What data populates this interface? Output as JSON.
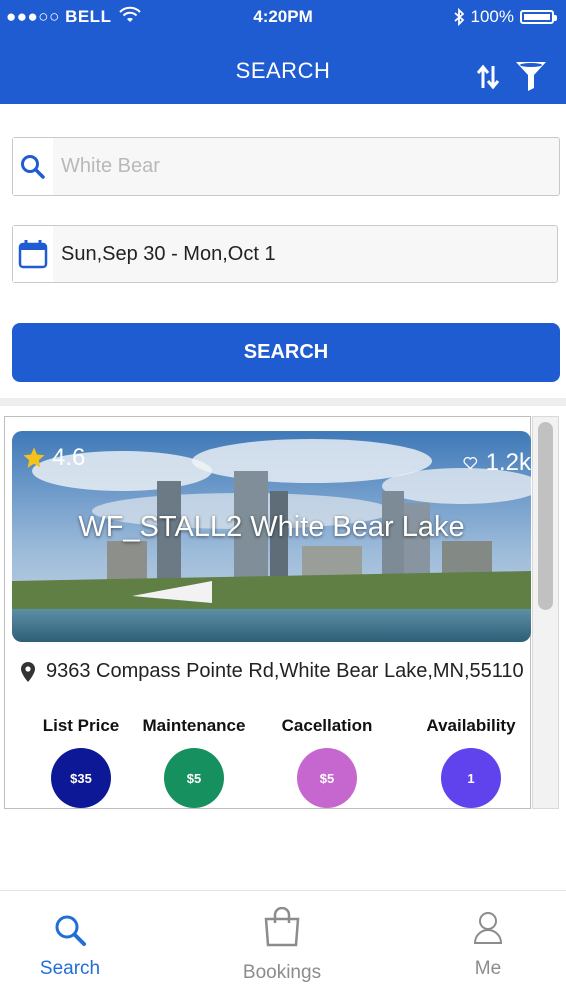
{
  "status_bar": {
    "carrier": "●●●○○ BELL",
    "time": "4:20PM",
    "battery": "100%"
  },
  "header": {
    "title": "SEARCH",
    "sort_icon": "sort-arrows-icon",
    "filter_icon": "filter-funnel-icon"
  },
  "search": {
    "placeholder": "White Bear",
    "icon": "search-icon"
  },
  "date_range": {
    "value": "Sun,Sep 30 - Mon,Oct 1",
    "icon": "calendar-icon"
  },
  "search_button": {
    "label": "SEARCH"
  },
  "result": {
    "rating": "4.6",
    "favorites": "1.2k",
    "title": "WF_STALL2 White Bear Lake",
    "address": "9363 Compass Pointe Rd,White Bear Lake,MN,55110",
    "prices": [
      {
        "label": "List Price",
        "value": "$35",
        "color": "#0c1896"
      },
      {
        "label": "Maintenance",
        "value": "$5",
        "color": "#17905f"
      },
      {
        "label": "Cacellation",
        "value": "$5",
        "color": "#c667cf"
      },
      {
        "label": "Availability",
        "value": "1",
        "color": "#6143ee"
      }
    ]
  },
  "tabs": [
    {
      "label": "Search",
      "icon": "search-icon",
      "active": true
    },
    {
      "label": "Bookings",
      "icon": "shopping-bag-icon",
      "active": false
    },
    {
      "label": "Me",
      "icon": "user-icon",
      "active": false
    }
  ],
  "colors": {
    "primary": "#1f5bd1",
    "star": "#f4c21b"
  }
}
